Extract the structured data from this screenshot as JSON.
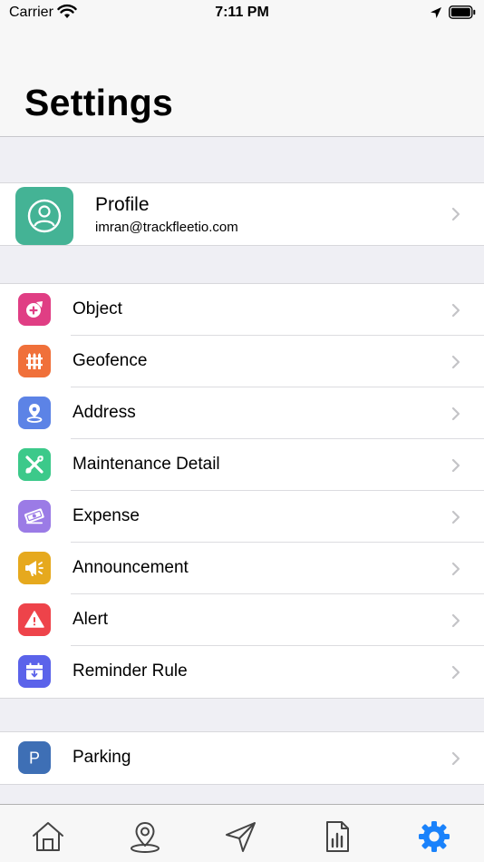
{
  "status_bar": {
    "carrier": "Carrier",
    "time": "7:11 PM"
  },
  "header": {
    "title": "Settings"
  },
  "profile": {
    "name": "Profile",
    "email": "imran@trackfleetio.com"
  },
  "menu_main": [
    {
      "label": "Object",
      "icon": "object-icon",
      "color": "#e03e84"
    },
    {
      "label": "Geofence",
      "icon": "geofence-icon",
      "color": "#f0703a"
    },
    {
      "label": "Address",
      "icon": "address-pin-icon",
      "color": "#5c83e6"
    },
    {
      "label": "Maintenance Detail",
      "icon": "maintenance-tools-icon",
      "color": "#3cc98a"
    },
    {
      "label": "Expense",
      "icon": "expense-money-icon",
      "color": "#9b7be6"
    },
    {
      "label": "Announcement",
      "icon": "announcement-megaphone-icon",
      "color": "#e6a91e"
    },
    {
      "label": "Alert",
      "icon": "alert-warning-icon",
      "color": "#ee434a"
    },
    {
      "label": "Reminder Rule",
      "icon": "reminder-calendar-icon",
      "color": "#5b63ea"
    }
  ],
  "menu_extra": [
    {
      "label": "Parking",
      "icon": "parking-icon",
      "color": "#3e6fb5"
    }
  ],
  "tab_bar": {
    "tabs": [
      "home-tab",
      "map-tab",
      "navigation-tab",
      "reports-tab",
      "settings-tab"
    ],
    "active": "settings-tab",
    "active_color": "#1a82fb",
    "inactive_color": "#444444"
  }
}
